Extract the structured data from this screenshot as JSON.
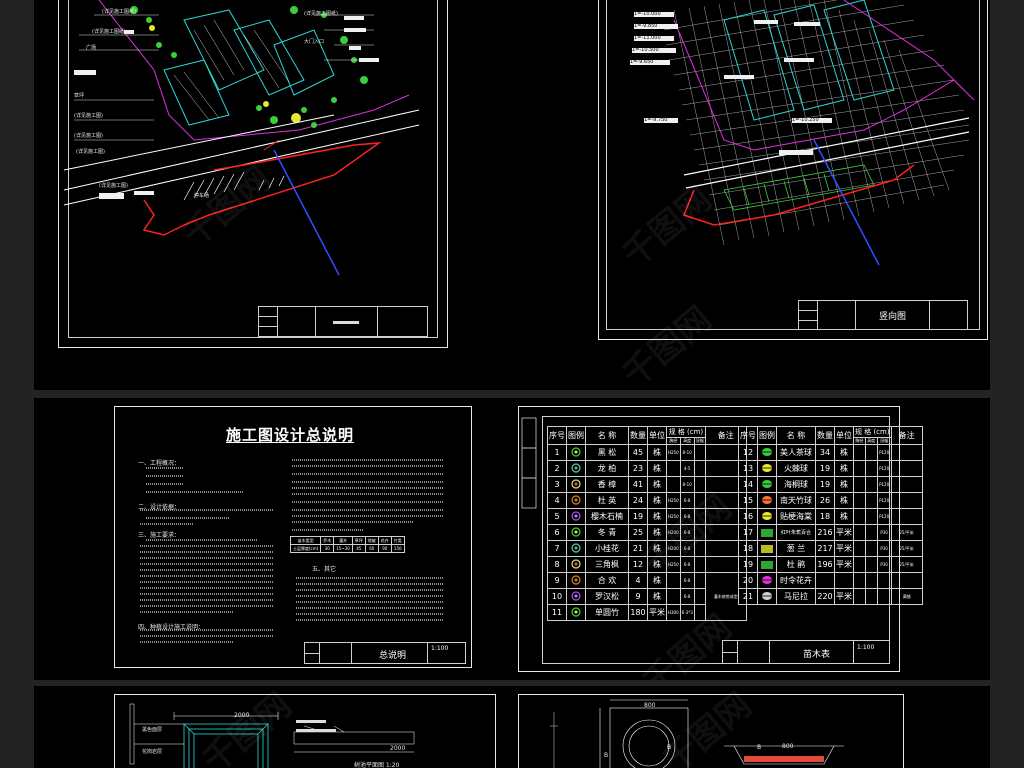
{
  "site_plan": {
    "labels": [
      "(详见施工图纸)",
      "(详见施工图纸)",
      "(详见施工图纸)",
      "广场",
      "草坪",
      "(详见施工图)",
      "(详见施工图)",
      "(详见施工图)",
      "大门入口",
      "停车场",
      "(详见施工图)"
    ]
  },
  "grading_plan": {
    "elevations": [
      "1=-10.000",
      "1=-9.850",
      "1=-11.000",
      "1=-10.500",
      "1=-9.650",
      "1=-9.750",
      "1=-10.250"
    ],
    "sheet_name": "竖向图"
  },
  "notes_sheet": {
    "title": "施工图设计总说明",
    "sections": [
      "一、工程概况：",
      "二、设计依据：",
      "三、施工要求：",
      "四、种植设计施工说明：",
      "五、其它"
    ],
    "table_header": [
      "苗木类型",
      "乔木",
      "灌木",
      "草坪",
      "地被",
      "花卉",
      "竹类"
    ],
    "table_values": [
      "土层厚度(cm)",
      "30",
      "15~30",
      "45",
      "60",
      "90",
      "150"
    ],
    "sheet_name": "总说明",
    "sheet_no": "1:100"
  },
  "plant_list": {
    "columns": [
      "序号",
      "图例",
      "名 称",
      "数量",
      "单位",
      "规 格 (cm)",
      "备注"
    ],
    "spec_sub": [
      "胸径",
      "高度",
      "冠幅"
    ],
    "left": [
      {
        "no": "1",
        "name": "黑 松",
        "qty": "45",
        "unit": "株",
        "spec": "H250",
        "spec2": "8-10"
      },
      {
        "no": "2",
        "name": "龙 柏",
        "qty": "23",
        "unit": "株",
        "spec": "",
        "spec2": "4-5"
      },
      {
        "no": "3",
        "name": "香 樟",
        "qty": "41",
        "unit": "株",
        "spec": "",
        "spec2": "8-10"
      },
      {
        "no": "4",
        "name": "杜 英",
        "qty": "24",
        "unit": "株",
        "spec": "H250",
        "spec2": "6-8"
      },
      {
        "no": "5",
        "name": "樱木石楠",
        "qty": "19",
        "unit": "株",
        "spec": "H250",
        "spec2": "6-8"
      },
      {
        "no": "6",
        "name": "冬 青",
        "qty": "25",
        "unit": "株",
        "spec": "H200",
        "spec2": "6-8"
      },
      {
        "no": "7",
        "name": "小桂花",
        "qty": "21",
        "unit": "株",
        "spec": "H200",
        "spec2": "6-8"
      },
      {
        "no": "8",
        "name": "三角枫",
        "qty": "12",
        "unit": "株",
        "spec": "H250",
        "spec2": "6-8"
      },
      {
        "no": "9",
        "name": "合 欢",
        "qty": "4",
        "unit": "株",
        "spec": "",
        "spec2": "6-8"
      },
      {
        "no": "10",
        "name": "罗汉松",
        "qty": "9",
        "unit": "株",
        "spec": "",
        "spec2": "6-8"
      },
      {
        "no": "11",
        "name": "单圆竹",
        "qty": "180",
        "unit": "平米",
        "spec": "H300",
        "spec2": "6-3*3"
      }
    ],
    "left_remark": "灌木修剪成型",
    "right": [
      {
        "no": "12",
        "name": "美人茶球",
        "qty": "34",
        "unit": "株",
        "spec": "P120",
        "remark": ""
      },
      {
        "no": "13",
        "name": "火棘球",
        "qty": "19",
        "unit": "株",
        "spec": "P120",
        "remark": ""
      },
      {
        "no": "14",
        "name": "海桐球",
        "qty": "19",
        "unit": "株",
        "spec": "P120",
        "remark": ""
      },
      {
        "no": "15",
        "name": "南天竹球",
        "qty": "26",
        "unit": "株",
        "spec": "P120",
        "remark": ""
      },
      {
        "no": "16",
        "name": "贴梗海棠",
        "qty": "18",
        "unit": "株",
        "spec": "P120",
        "remark": ""
      },
      {
        "no": "17",
        "name": "红叶朱蕉百合",
        "qty": "216",
        "unit": "平米",
        "spec": "P30",
        "remark": "25/平米"
      },
      {
        "no": "18",
        "name": "葱 兰",
        "qty": "217",
        "unit": "平米",
        "spec": "P30",
        "remark": "25/平米"
      },
      {
        "no": "19",
        "name": "杜 鹃",
        "qty": "196",
        "unit": "平米",
        "spec": "P30",
        "remark": "25/平米"
      },
      {
        "no": "20",
        "name": "时令花卉",
        "qty": "",
        "unit": "",
        "spec": "",
        "remark": ""
      },
      {
        "no": "21",
        "name": "马尼拉",
        "qty": "220",
        "unit": "平米",
        "spec": "",
        "remark": "满铺"
      }
    ],
    "sheet_name": "苗木表",
    "sheet_no": "1:100"
  },
  "detail_left": {
    "dims": [
      "2000",
      "2000"
    ],
    "labels": [
      "黑色面层",
      "花岗岩层"
    ],
    "section_title": "树池平面图 1:20"
  },
  "detail_right": {
    "dims": [
      "800",
      "800",
      "B",
      "B",
      "B"
    ]
  },
  "watermark": "千图网"
}
